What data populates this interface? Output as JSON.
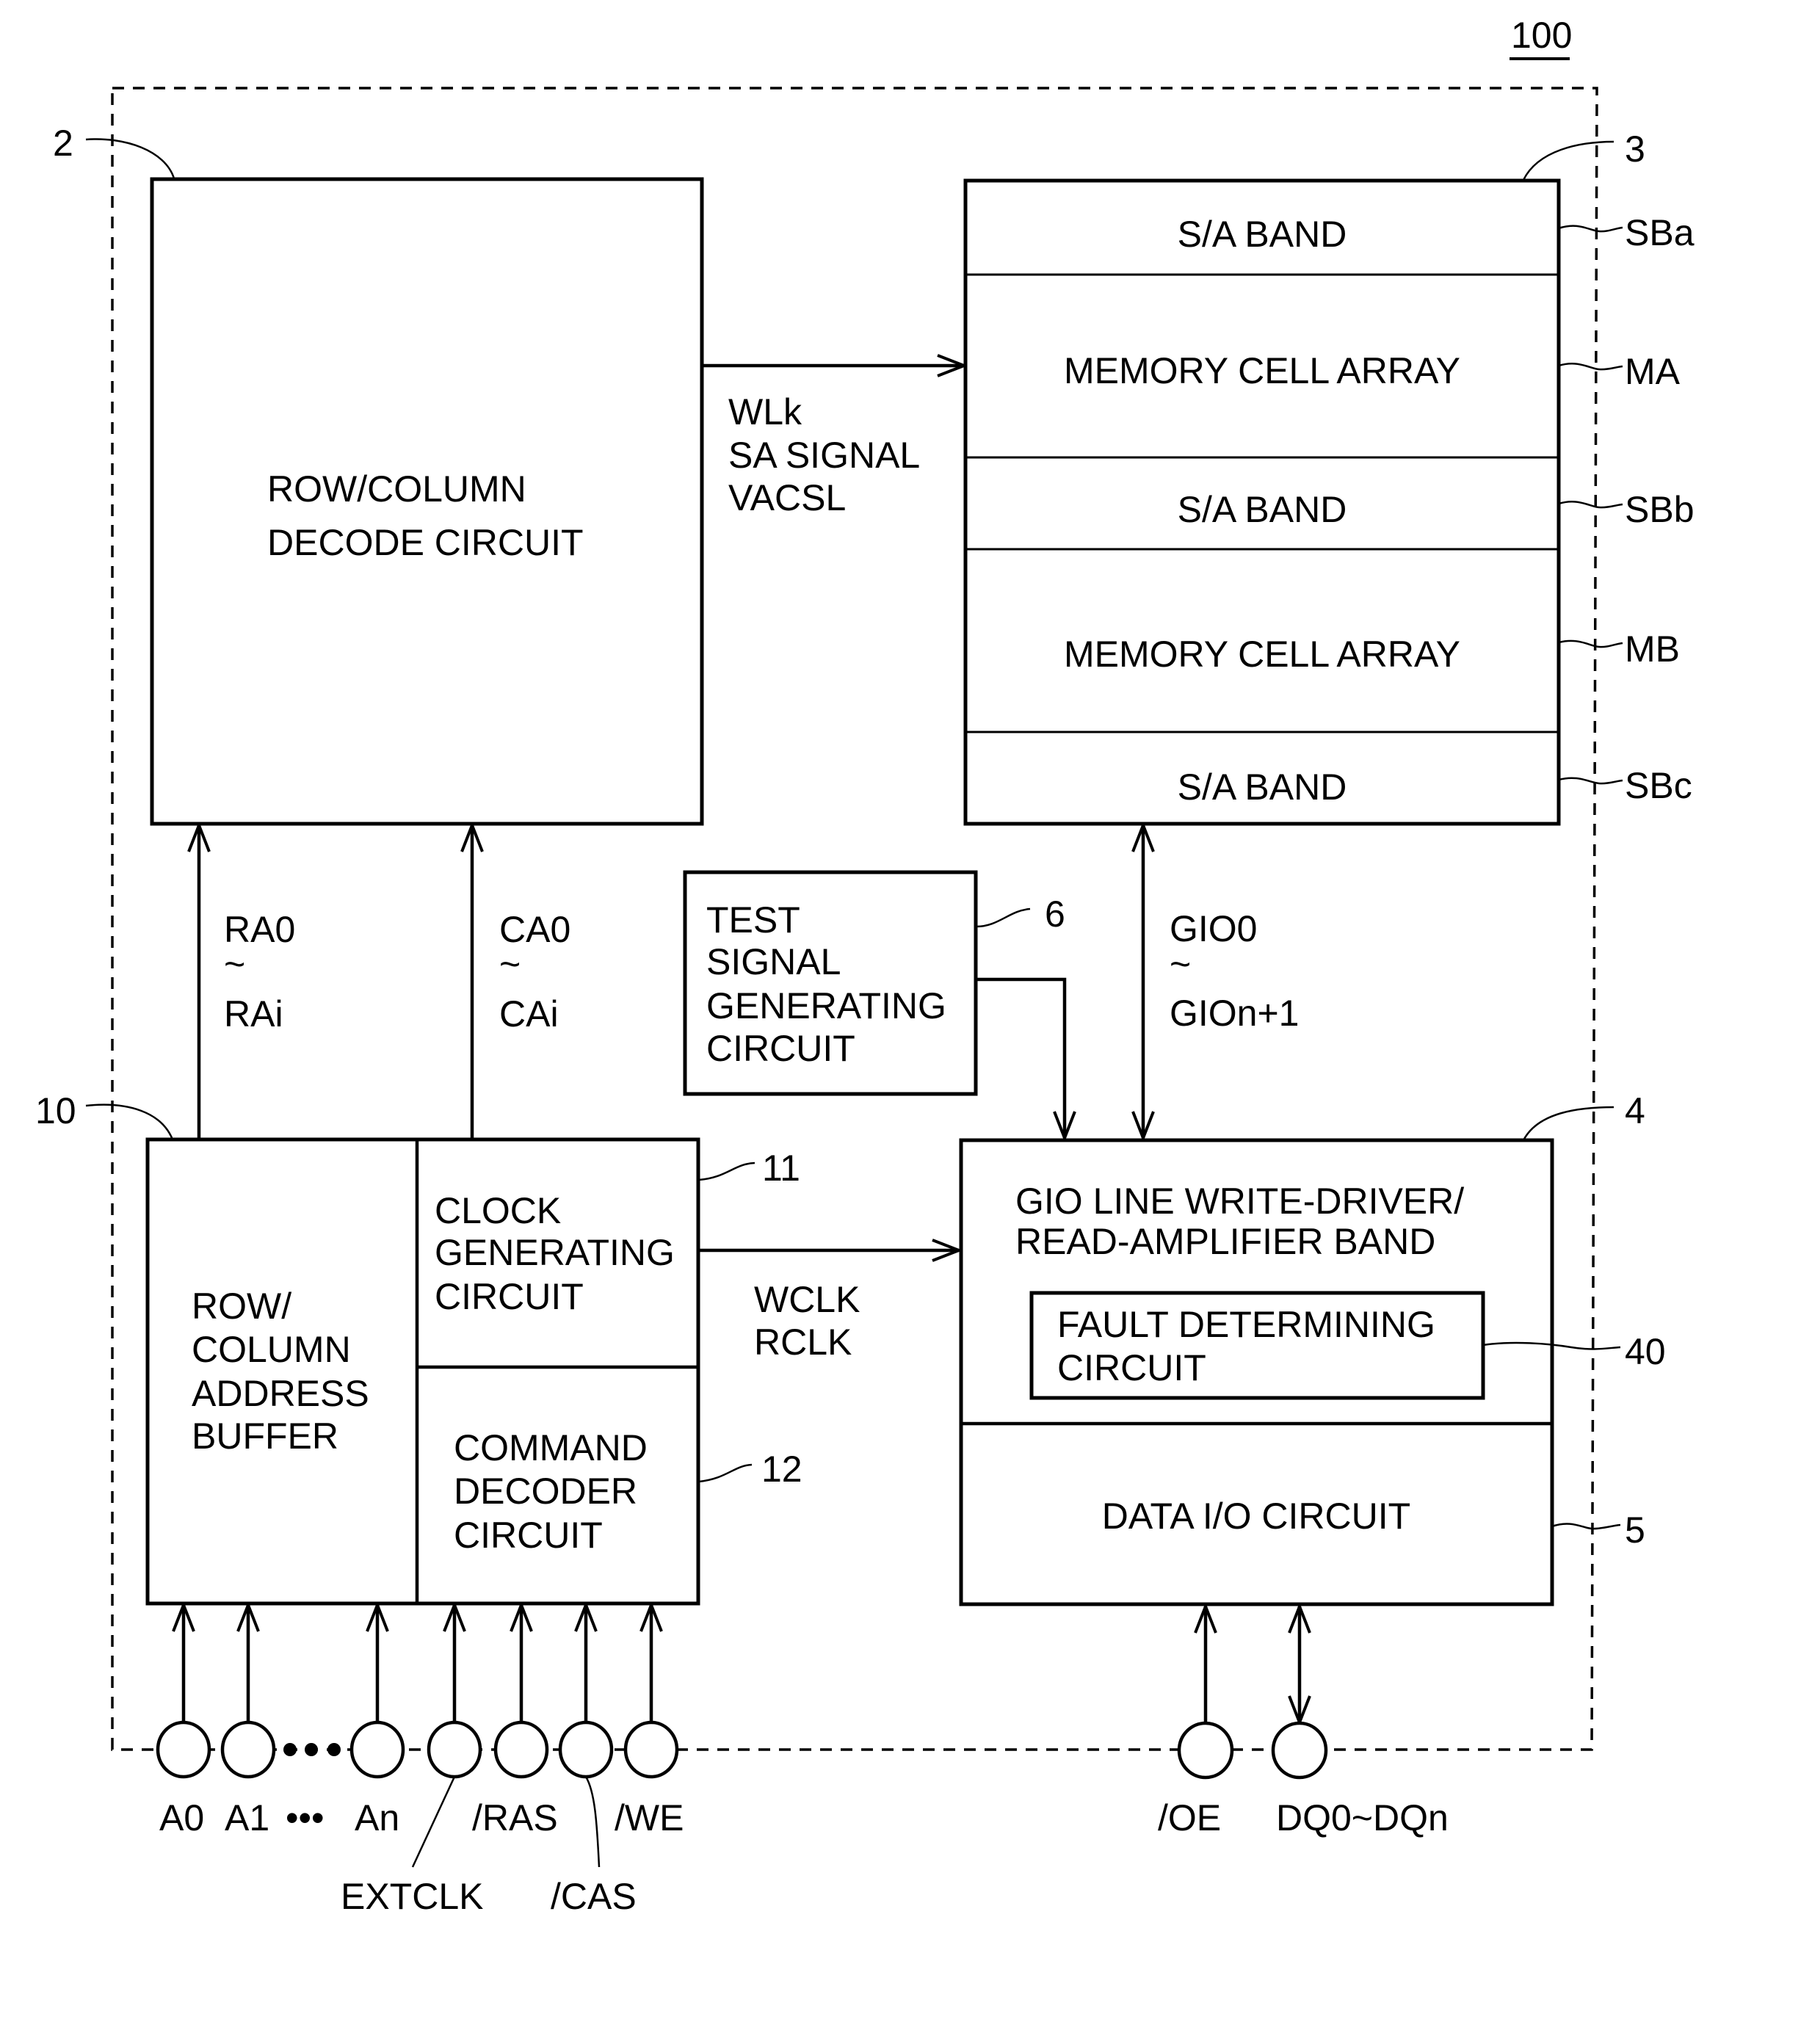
{
  "figure": {
    "reference": "100",
    "domain": "DRAM block diagram"
  },
  "blocks": {
    "decode": {
      "ref": "2",
      "lines": [
        "ROW/COLUMN",
        "DECODE CIRCUIT"
      ]
    },
    "memory": {
      "ref": "3",
      "bands": [
        {
          "label": "S/A BAND",
          "tag": "SBa"
        },
        {
          "label": "MEMORY CELL ARRAY",
          "tag": "MA"
        },
        {
          "label": "S/A BAND",
          "tag": "SBb"
        },
        {
          "label": "MEMORY CELL ARRAY",
          "tag": "MB"
        },
        {
          "label": "S/A BAND",
          "tag": "SBc"
        }
      ]
    },
    "test_signal": {
      "ref": "6",
      "lines": [
        "TEST",
        "SIGNAL",
        "GENERATING",
        "CIRCUIT"
      ]
    },
    "address_buffer": {
      "ref": "10",
      "lines": [
        "ROW/",
        "COLUMN",
        "ADDRESS",
        "BUFFER"
      ]
    },
    "clock_gen": {
      "ref": "11",
      "lines": [
        "CLOCK",
        "GENERATING",
        "CIRCUIT"
      ]
    },
    "command_decoder": {
      "ref": "12",
      "lines": [
        "COMMAND",
        "DECODER",
        "CIRCUIT"
      ]
    },
    "gio_band": {
      "ref": "4",
      "lines": [
        "GIO LINE WRITE-DRIVER/",
        "READ-AMPLIFIER BAND"
      ]
    },
    "fault": {
      "ref": "40",
      "lines": [
        "FAULT DETERMINING",
        "CIRCUIT"
      ]
    },
    "data_io": {
      "ref": "5",
      "label": "DATA I/O CIRCUIT"
    }
  },
  "signals": {
    "decode_to_memory": [
      "WLk",
      "SA SIGNAL",
      "VACSL"
    ],
    "row_address": [
      "RA0",
      "~",
      "RAi"
    ],
    "column_address": [
      "CA0",
      "~",
      "CAi"
    ],
    "gio": [
      "GIO0",
      "~",
      "GIOn+1"
    ],
    "clock": [
      "WCLK",
      "RCLK"
    ]
  },
  "pins": {
    "left": [
      "A0",
      "A1",
      "An",
      "EXTCLK",
      "/RAS",
      "/CAS",
      "/WE"
    ],
    "ellipsis": "•••",
    "right": [
      "/OE",
      "DQ0~DQn"
    ]
  }
}
